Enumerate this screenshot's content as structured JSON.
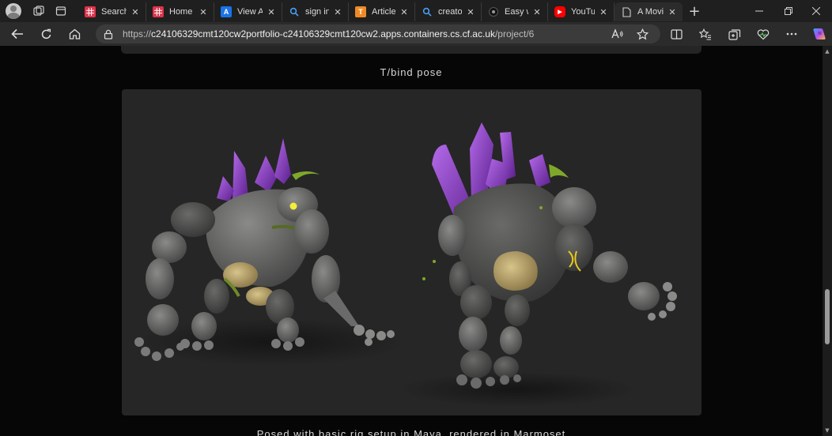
{
  "browser": {
    "tabs": [
      {
        "title": "Search",
        "favicon": "tiled-red-icon",
        "color": "#e0334b",
        "glyph": ""
      },
      {
        "title": "Home :",
        "favicon": "tiled-red-icon",
        "color": "#e0334b",
        "glyph": ""
      },
      {
        "title": "View As",
        "favicon": "a-logo-icon",
        "color": "#1a73e8",
        "glyph": "A"
      },
      {
        "title": "sign in t",
        "favicon": "search-icon",
        "color": "#2b2b2b",
        "glyph": ""
      },
      {
        "title": "Article",
        "favicon": "t-logo-icon",
        "color": "#f08a24",
        "glyph": "T"
      },
      {
        "title": "creator",
        "favicon": "search-icon",
        "color": "#2b2b2b",
        "glyph": ""
      },
      {
        "title": "Easy wa",
        "favicon": "dark-circle-icon",
        "color": "#111111",
        "glyph": ""
      },
      {
        "title": "YouTub",
        "favicon": "youtube-icon",
        "color": "#ff0000",
        "glyph": "▶"
      },
      {
        "title": "A Movie",
        "favicon": "document-icon",
        "color": "#2b2b2b",
        "glyph": ""
      }
    ],
    "address": {
      "scheme": "https://",
      "host": "c24106329cmt120cw2portfolio-c24106329cmt120cw2.apps.containers.cs.cf.ac.uk",
      "path": "/project/6"
    }
  },
  "page": {
    "caption_top": "T/bind pose",
    "caption_bottom": "Posed with basic rig setup in Maya, rendered in Marmoset"
  },
  "colors": {
    "stage_bg": "#262626",
    "rock": "#5a5a5a",
    "crystal": "#8a3fc4",
    "bone": "#b9a46b",
    "moss": "#6e8a2a",
    "glow": "#e8e21e"
  }
}
